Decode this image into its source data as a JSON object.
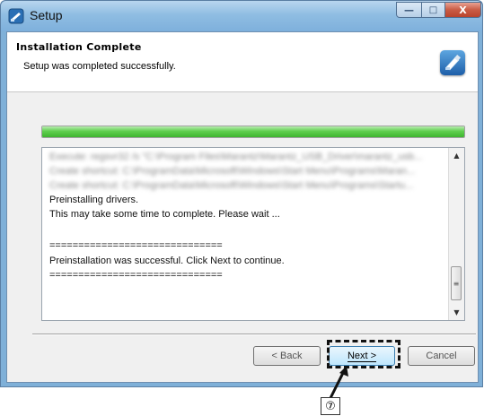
{
  "window": {
    "title": "Setup",
    "controls": {
      "minimize": "—",
      "maximize": "□",
      "close": "X"
    }
  },
  "header": {
    "title": "Installation Complete",
    "subtitle": "Setup was completed successfully."
  },
  "progress": {
    "value": 1.0
  },
  "log": {
    "blurred_lines": [
      "Execute: regsvr32 /s \"C:\\Program Files\\Marantz\\Marantz_USB_Driver\\marantz_usb...",
      "Create shortcut: C:\\ProgramData\\Microsoft\\Windows\\Start Menu\\Programs\\Maran...",
      "Create shortcut: C:\\ProgramData\\Microsoft\\Windows\\Start Menu\\Programs\\Startu..."
    ],
    "lines": [
      "Preinstalling drivers.",
      "This may take some time to complete. Please wait ...",
      "",
      "==============================",
      "Preinstallation was successful. Click Next to continue.",
      "=============================="
    ]
  },
  "buttons": {
    "back": "< Back",
    "next": "Next >",
    "cancel": "Cancel"
  },
  "annotation": {
    "callout": "⑦"
  },
  "colors": {
    "titlebar": "#8fbde2",
    "progress_fill": "#5fcf4e",
    "next_button_border": "#3c7fb1",
    "highlight_border": "#111111"
  }
}
